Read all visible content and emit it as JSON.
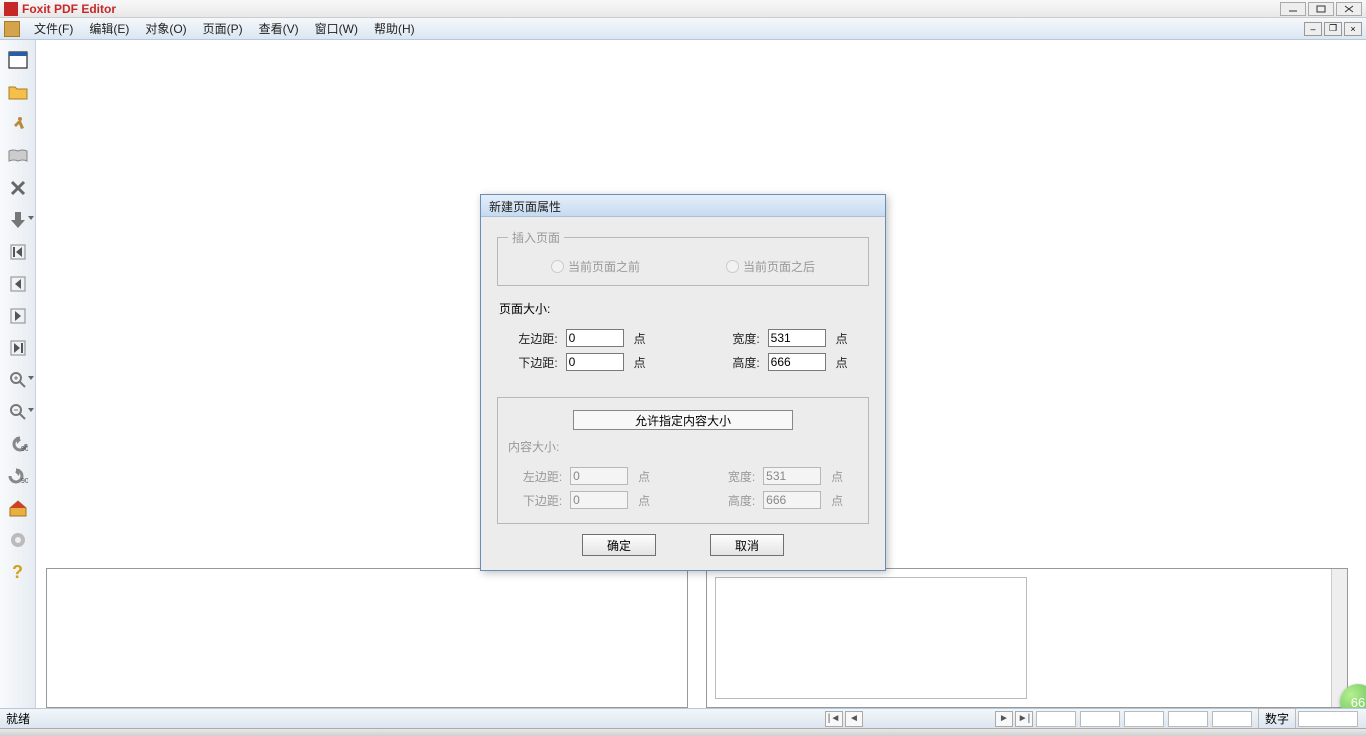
{
  "app": {
    "title": "Foxit PDF Editor"
  },
  "menu": {
    "file": "文件(F)",
    "edit": "编辑(E)",
    "object": "对象(O)",
    "page": "页面(P)",
    "view": "查看(V)",
    "window": "窗口(W)",
    "help": "帮助(H)"
  },
  "statusbar": {
    "ready": "就绪",
    "numlock": "数字"
  },
  "bubble": {
    "value": "66"
  },
  "dialog": {
    "title": "新建页面属性",
    "insert_group": "插入页面",
    "radio_before": "当前页面之前",
    "radio_after": "当前页面之后",
    "page_size_label": "页面大小:",
    "content_size_label": "内容大小:",
    "left_margin": "左边距:",
    "bottom_margin": "下边距:",
    "width": "宽度:",
    "height": "高度:",
    "unit": "点",
    "allow_button": "允许指定内容大小",
    "ok": "确定",
    "cancel": "取消",
    "page": {
      "left": "0",
      "bottom": "0",
      "width": "531",
      "height": "666"
    },
    "content": {
      "left": "0",
      "bottom": "0",
      "width": "531",
      "height": "666"
    }
  }
}
